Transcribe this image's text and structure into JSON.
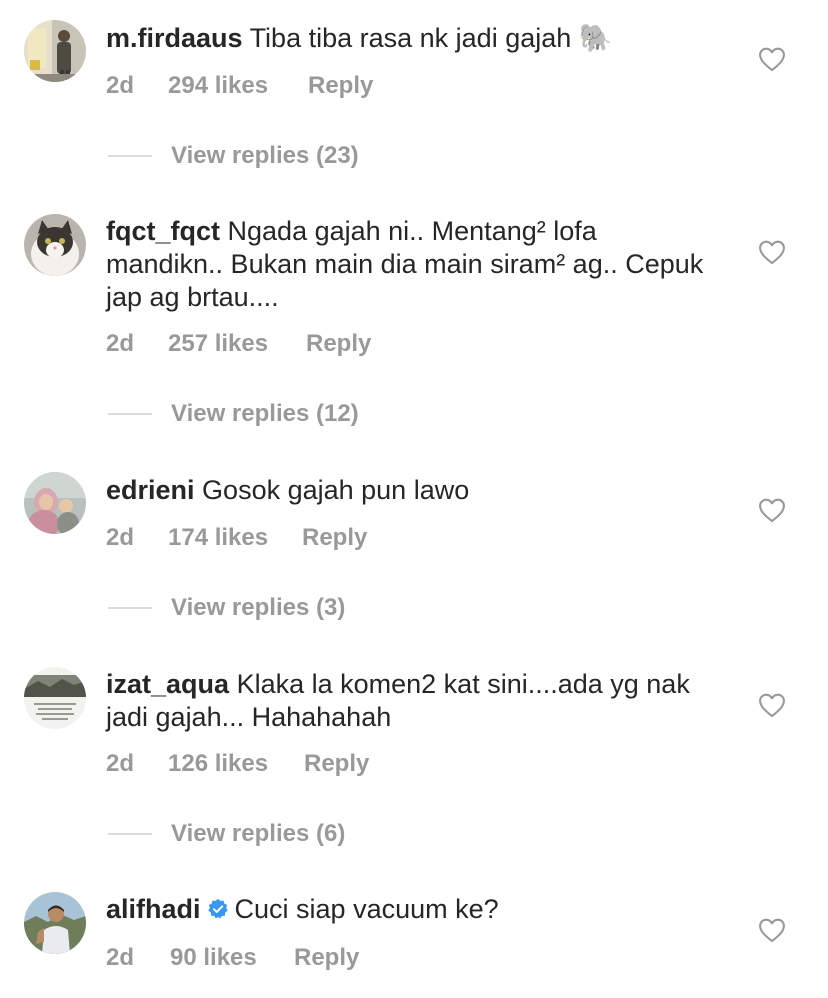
{
  "comments": [
    {
      "username": "m.firdaaus",
      "text": "Tiba tiba rasa nk jadi gajah 🐘",
      "time": "2d",
      "likes": "294 likes",
      "reply": "Reply",
      "view_replies": "View replies (23)"
    },
    {
      "username": "fqct_fqct",
      "text": "Ngada gajah ni.. Mentang² lofa mandikn.. Bukan main dia main siram² ag.. Cepuk jap ag brtau....",
      "time": "2d",
      "likes": "257 likes",
      "reply": "Reply",
      "view_replies": "View replies (12)"
    },
    {
      "username": "edrieni",
      "text": "Gosok gajah pun lawo",
      "time": "2d",
      "likes": "174 likes",
      "reply": "Reply",
      "view_replies": "View replies (3)"
    },
    {
      "username": "izat_aqua",
      "text": "Klaka la komen2 kat sini....ada yg nak jadi gajah... Hahahahah",
      "time": "2d",
      "likes": "126 likes",
      "reply": "Reply",
      "view_replies": "View replies (6)"
    },
    {
      "username": "alifhadi",
      "verified": true,
      "text": "Cuci siap vacuum ke?",
      "time": "2d",
      "likes": "90 likes",
      "reply": "Reply"
    }
  ],
  "icons": {
    "heart": "heart-outline-icon",
    "verified": "verified-badge-icon"
  },
  "colors": {
    "text": "#262626",
    "meta": "#999999",
    "divider": "#dbdbdb",
    "verified": "#3897f0"
  }
}
